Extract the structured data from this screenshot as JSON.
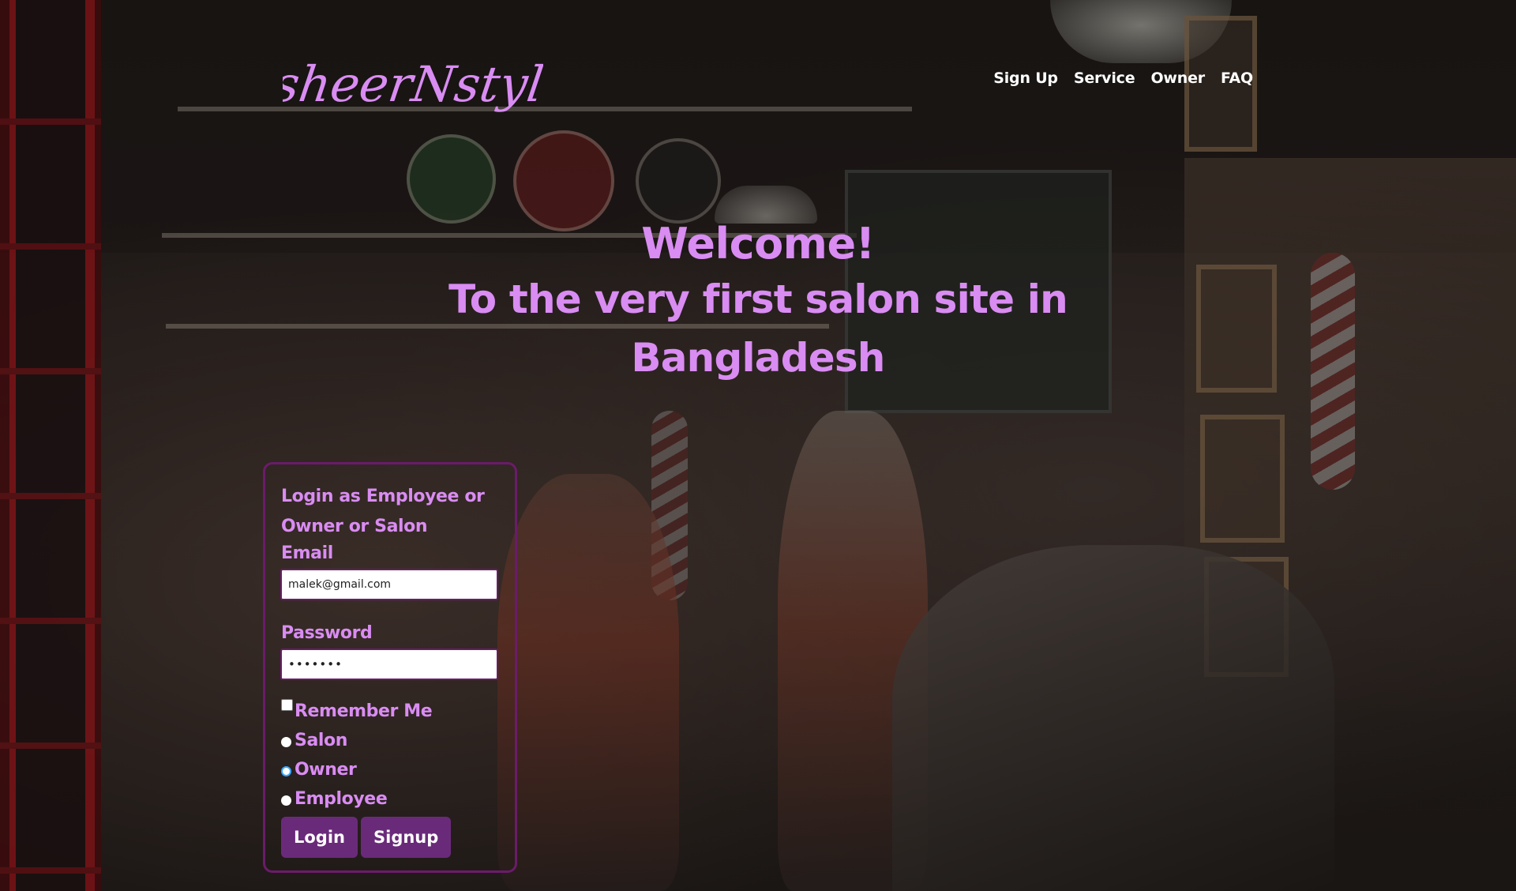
{
  "brand": {
    "logo_text": "sheerNstyle",
    "accent_color": "#d98cf2"
  },
  "nav": {
    "items": [
      {
        "label": "Sign Up"
      },
      {
        "label": "Service"
      },
      {
        "label": "Owner"
      },
      {
        "label": "FAQ"
      }
    ]
  },
  "hero": {
    "title": "Welcome!",
    "subtitle": "To the very first salon site in Bangladesh"
  },
  "login": {
    "heading": "Login as Employee or Owner or Salon",
    "email_label": "Email",
    "email_value": "malek@gmail.com",
    "password_label": "Password",
    "password_value": "•••••••",
    "remember_label": "Remember Me",
    "remember_checked": false,
    "roles": [
      {
        "label": "Salon",
        "selected": false
      },
      {
        "label": "Owner",
        "selected": false,
        "focused": true
      },
      {
        "label": "Employee",
        "selected": false
      }
    ],
    "login_button": "Login",
    "signup_button": "Signup",
    "button_color": "#6a2a7a",
    "border_color": "#6b1b6b"
  }
}
